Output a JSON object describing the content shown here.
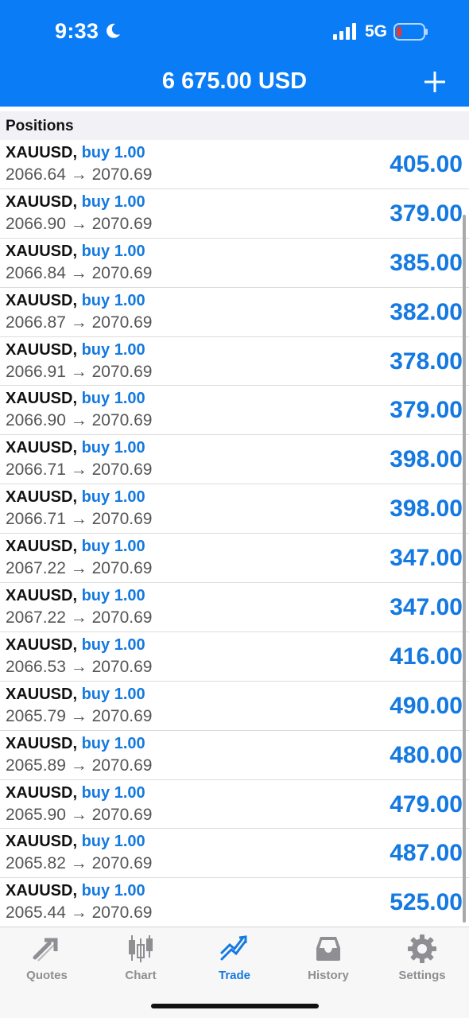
{
  "status": {
    "time": "9:33",
    "network": "5G"
  },
  "header": {
    "balance": "6 675.00 USD"
  },
  "section": {
    "title": "Positions"
  },
  "positions": [
    {
      "symbol": "XAUUSD,",
      "side": "buy 1.00",
      "prices": "2066.64 → 2070.69",
      "profit": "405.00"
    },
    {
      "symbol": "XAUUSD,",
      "side": "buy 1.00",
      "prices": "2066.90 → 2070.69",
      "profit": "379.00"
    },
    {
      "symbol": "XAUUSD,",
      "side": "buy 1.00",
      "prices": "2066.84 → 2070.69",
      "profit": "385.00"
    },
    {
      "symbol": "XAUUSD,",
      "side": "buy 1.00",
      "prices": "2066.87 → 2070.69",
      "profit": "382.00"
    },
    {
      "symbol": "XAUUSD,",
      "side": "buy 1.00",
      "prices": "2066.91 → 2070.69",
      "profit": "378.00"
    },
    {
      "symbol": "XAUUSD,",
      "side": "buy 1.00",
      "prices": "2066.90 → 2070.69",
      "profit": "379.00"
    },
    {
      "symbol": "XAUUSD,",
      "side": "buy 1.00",
      "prices": "2066.71 → 2070.69",
      "profit": "398.00"
    },
    {
      "symbol": "XAUUSD,",
      "side": "buy 1.00",
      "prices": "2066.71 → 2070.69",
      "profit": "398.00"
    },
    {
      "symbol": "XAUUSD,",
      "side": "buy 1.00",
      "prices": "2067.22 → 2070.69",
      "profit": "347.00"
    },
    {
      "symbol": "XAUUSD,",
      "side": "buy 1.00",
      "prices": "2067.22 → 2070.69",
      "profit": "347.00"
    },
    {
      "symbol": "XAUUSD,",
      "side": "buy 1.00",
      "prices": "2066.53 → 2070.69",
      "profit": "416.00"
    },
    {
      "symbol": "XAUUSD,",
      "side": "buy 1.00",
      "prices": "2065.79 → 2070.69",
      "profit": "490.00"
    },
    {
      "symbol": "XAUUSD,",
      "side": "buy 1.00",
      "prices": "2065.89 → 2070.69",
      "profit": "480.00"
    },
    {
      "symbol": "XAUUSD,",
      "side": "buy 1.00",
      "prices": "2065.90 → 2070.69",
      "profit": "479.00"
    },
    {
      "symbol": "XAUUSD,",
      "side": "buy 1.00",
      "prices": "2065.82 → 2070.69",
      "profit": "487.00"
    },
    {
      "symbol": "XAUUSD,",
      "side": "buy 1.00",
      "prices": "2065.44 → 2070.69",
      "profit": "525.00"
    }
  ],
  "tabs": [
    {
      "label": "Quotes",
      "icon": "quotes-icon"
    },
    {
      "label": "Chart",
      "icon": "chart-icon"
    },
    {
      "label": "Trade",
      "icon": "trade-icon",
      "active": true
    },
    {
      "label": "History",
      "icon": "history-icon"
    },
    {
      "label": "Settings",
      "icon": "gear-icon"
    }
  ],
  "colors": {
    "accent": "#0a7cf6",
    "profit": "#1479e0",
    "inactive": "#8e8e93",
    "battery_low": "#e53935"
  }
}
